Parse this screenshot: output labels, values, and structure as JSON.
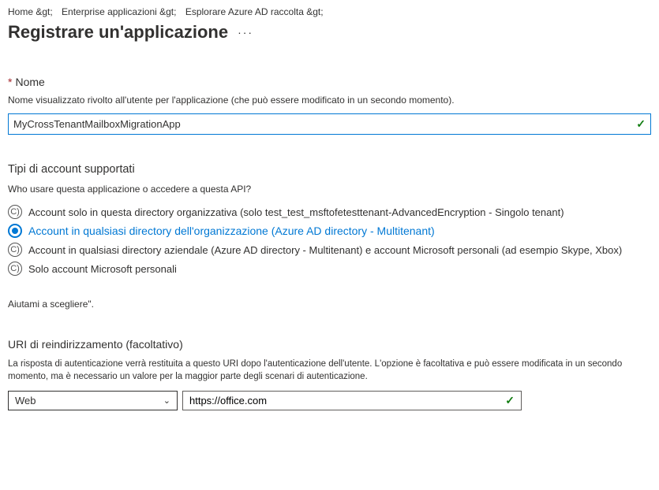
{
  "breadcrumb": {
    "items": [
      "Home &gt;",
      "Enterprise applicazioni &gt;",
      "Esplorare Azure AD raccolta &gt;"
    ]
  },
  "page_title": "Registrare un'applicazione",
  "more_dots": "···",
  "name": {
    "label": "Nome",
    "desc": "Nome visualizzato rivolto all'utente per l'applicazione (che può essere modificato in un secondo momento).",
    "value": "MyCrossTenantMailboxMigrationApp"
  },
  "accounts": {
    "heading": "Tipi di account supportati",
    "question": "Who usare questa applicazione o accedere a questa API?",
    "options": [
      {
        "marker": "C)",
        "label": "Account solo in questa directory organizzativa (solo test_test_msftofetesttenant-AdvancedEncryption - Singolo tenant)"
      },
      {
        "marker": "●",
        "label": "Account in qualsiasi directory dell'organizzazione (Azure AD directory - Multitenant)"
      },
      {
        "marker": "C)",
        "label": "Account in qualsiasi directory aziendale (Azure AD directory - Multitenant) e account Microsoft personali (ad esempio Skype, Xbox)"
      },
      {
        "marker": "C)",
        "label": "Solo account Microsoft personali"
      }
    ],
    "help": "Aiutami a scegliere\"."
  },
  "redirect": {
    "heading": "URI di reindirizzamento (facoltativo)",
    "desc": "La risposta di autenticazione verrà restituita a questo URI dopo l'autenticazione dell'utente. L'opzione è facoltativa e può essere modificata in un secondo momento, ma è necessario un valore per la maggior parte degli scenari di autenticazione.",
    "platform": "Web",
    "uri": "https://office.com"
  },
  "check": "✓",
  "chev": "⌄"
}
